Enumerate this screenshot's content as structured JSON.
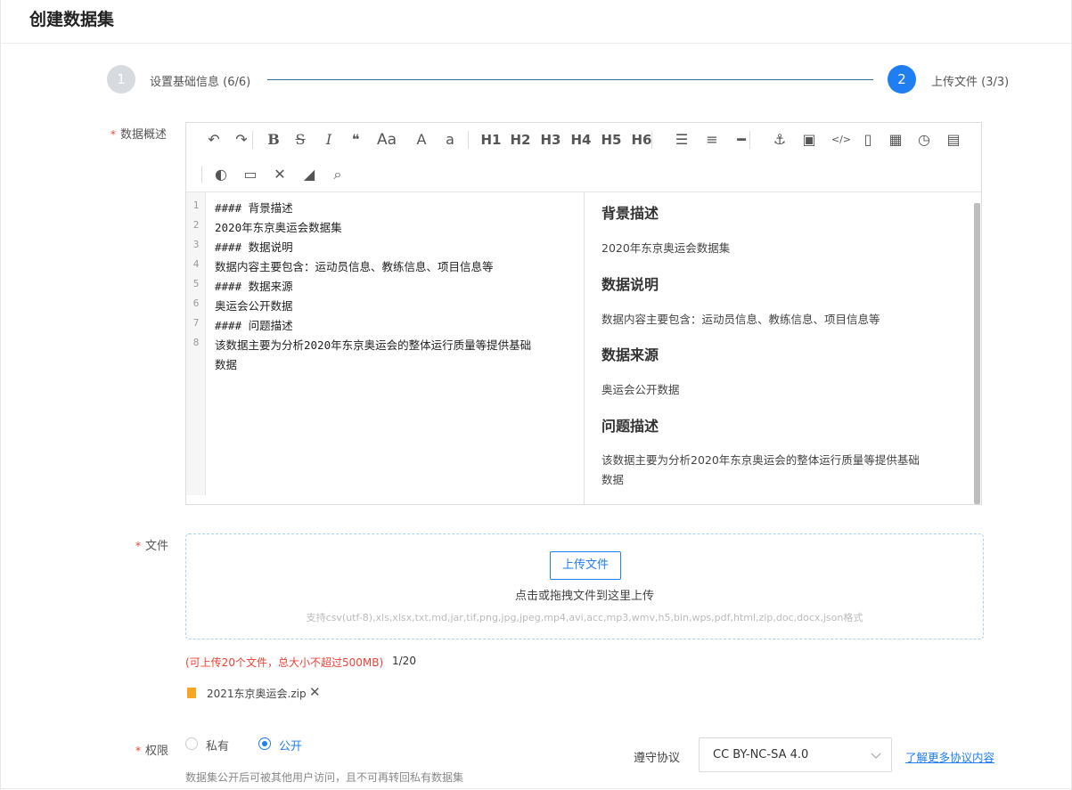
{
  "page": {
    "title": "创建数据集"
  },
  "steps": [
    {
      "number": "1",
      "label": "设置基础信息 (6/6)",
      "state": "done"
    },
    {
      "number": "2",
      "label": "上传文件 (3/3)",
      "state": "active"
    }
  ],
  "form": {
    "summary_label": "数据概述",
    "file_label": "文件",
    "permission_label": "权限",
    "required_mark": "*"
  },
  "toolbar": {
    "row1": [
      {
        "name": "undo-icon",
        "glyph": "↶"
      },
      {
        "name": "redo-icon",
        "glyph": "↷"
      },
      {
        "name": "bold-icon",
        "glyph": "B"
      },
      {
        "name": "strikethrough-icon",
        "glyph": "S"
      },
      {
        "name": "italic-icon",
        "glyph": "I"
      },
      {
        "name": "quote-icon",
        "glyph": "❝"
      },
      {
        "name": "font-size-icon",
        "glyph": "Aa"
      },
      {
        "name": "uppercase-icon",
        "glyph": "A"
      },
      {
        "name": "lowercase-icon",
        "glyph": "a"
      },
      {
        "name": "h1-icon",
        "glyph": "H1"
      },
      {
        "name": "h2-icon",
        "glyph": "H2"
      },
      {
        "name": "h3-icon",
        "glyph": "H3"
      },
      {
        "name": "h4-icon",
        "glyph": "H4"
      },
      {
        "name": "h5-icon",
        "glyph": "H5"
      },
      {
        "name": "h6-icon",
        "glyph": "H6"
      },
      {
        "name": "unordered-list-icon",
        "glyph": "☰"
      },
      {
        "name": "ordered-list-icon",
        "glyph": "≡"
      },
      {
        "name": "horizontal-rule-icon",
        "glyph": "━"
      },
      {
        "name": "anchor-icon",
        "glyph": "⚓"
      },
      {
        "name": "image-icon",
        "glyph": "▣"
      },
      {
        "name": "code-icon",
        "glyph": "</>"
      },
      {
        "name": "code-file-icon",
        "glyph": "▯"
      },
      {
        "name": "table-icon",
        "glyph": "▦"
      },
      {
        "name": "clock-icon",
        "glyph": "◷"
      },
      {
        "name": "html-entities-icon",
        "glyph": "▤"
      }
    ],
    "row2": [
      {
        "name": "toggle-preview-icon",
        "glyph": "◐"
      },
      {
        "name": "fullscreen-preview-icon",
        "glyph": "▭"
      },
      {
        "name": "fullscreen-icon",
        "glyph": "✕"
      },
      {
        "name": "eraser-icon",
        "glyph": "◢"
      },
      {
        "name": "search-icon",
        "glyph": "⌕"
      }
    ]
  },
  "editor": {
    "lines": [
      "#### 背景描述",
      "2020年东京奥运会数据集",
      "#### 数据说明",
      "数据内容主要包含：运动员信息、教练信息、项目信息等",
      "#### 数据来源",
      "奥运会公开数据",
      "#### 问题描述",
      "该数据主要为分析2020年东京奥运会的整体运行质量等提供基础",
      "数据"
    ],
    "line_numbers": [
      "1",
      "2",
      "3",
      "4",
      "5",
      "6",
      "7",
      "8"
    ]
  },
  "preview": {
    "sections": [
      {
        "heading": "背景描述",
        "text": "2020年东京奥运会数据集"
      },
      {
        "heading": "数据说明",
        "text": "数据内容主要包含：运动员信息、教练信息、项目信息等"
      },
      {
        "heading": "数据来源",
        "text": "奥运会公开数据"
      },
      {
        "heading": "问题描述",
        "text": "该数据主要为分析2020年东京奥运会的整体运行质量等提供基础",
        "text2": "数据"
      }
    ]
  },
  "upload": {
    "button_label": "上传文件",
    "hint": "点击或拖拽文件到这里上传",
    "formats": "支持csv(utf-8),xls,xlsx,txt,md,jar,tif,png,jpg,jpeg,mp4,avi,acc,mp3,wmv,h5,bin,wps,pdf,html,zip,doc,docx,json格式",
    "limit_warning": "(可上传20个文件，总大小不超过500MB)",
    "count": "1/20",
    "files": [
      {
        "name": "2021东京奥运会.zip"
      }
    ]
  },
  "permission": {
    "options": [
      {
        "label": "私有",
        "checked": false
      },
      {
        "label": "公开",
        "checked": true
      }
    ],
    "note": "数据集公开后可被其他用户访问，且不可再转回私有数据集",
    "license_label": "遵守协议",
    "license_value": "CC BY-NC-SA 4.0",
    "license_link": "了解更多协议内容"
  },
  "colors": {
    "accent": "#1e7ef2",
    "required": "#f04134",
    "step_line": "#2d6ea2"
  }
}
